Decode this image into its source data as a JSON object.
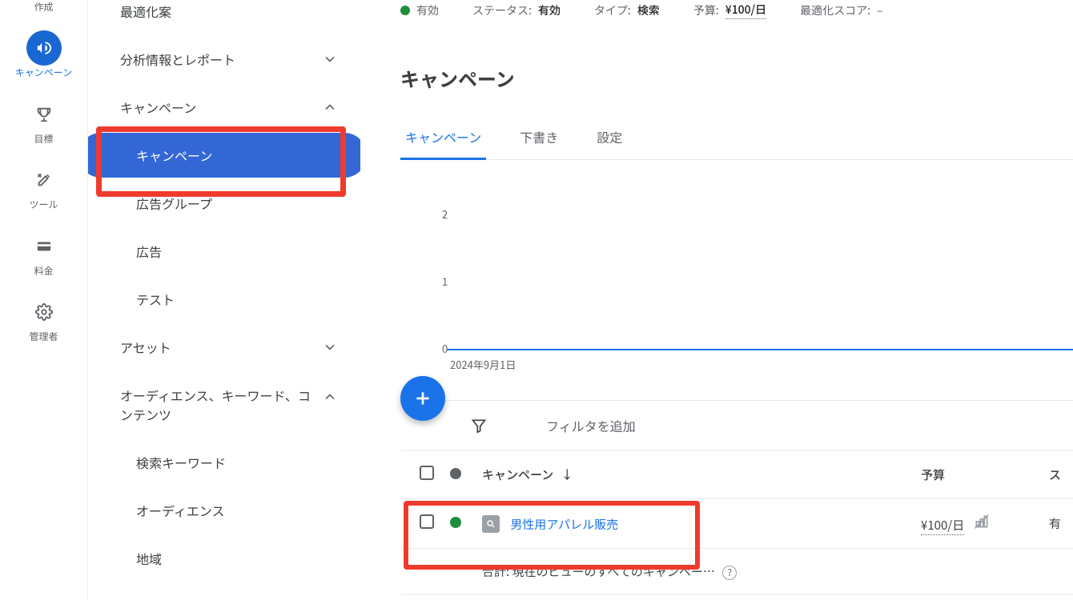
{
  "rail": {
    "items": [
      {
        "label": "作成",
        "icon": "plus"
      },
      {
        "label": "キャンペーン",
        "icon": "megaphone",
        "active": true
      },
      {
        "label": "目標",
        "icon": "trophy"
      },
      {
        "label": "ツール",
        "icon": "tools"
      },
      {
        "label": "料金",
        "icon": "card"
      },
      {
        "label": "管理者",
        "icon": "gear"
      }
    ]
  },
  "nav": {
    "sections": [
      {
        "label": "最適化案",
        "kind": "section",
        "expand": "none"
      },
      {
        "label": "分析情報とレポート",
        "kind": "section",
        "expand": "down"
      },
      {
        "label": "キャンペーン",
        "kind": "section",
        "expand": "up"
      },
      {
        "label": "キャンペーン",
        "kind": "sub",
        "selected": true
      },
      {
        "label": "広告グループ",
        "kind": "sub"
      },
      {
        "label": "広告",
        "kind": "sub"
      },
      {
        "label": "テスト",
        "kind": "sub"
      },
      {
        "label": "アセット",
        "kind": "section",
        "expand": "down"
      },
      {
        "label": "オーディエンス、キーワード、コンテンツ",
        "kind": "section",
        "expand": "up"
      },
      {
        "label": "検索キーワード",
        "kind": "sub"
      },
      {
        "label": "オーディエンス",
        "kind": "sub"
      },
      {
        "label": "地域",
        "kind": "sub"
      }
    ]
  },
  "statusbar": {
    "enabled_label": "有効",
    "status_label": "ステータス:",
    "status_value": "有効",
    "type_label": "タイプ:",
    "type_value": "検索",
    "budget_label": "予算:",
    "budget_value": "¥100/日",
    "opt_label": "最適化スコア:",
    "opt_value": "–"
  },
  "page_title": "キャンペーン",
  "tabs": [
    {
      "label": "キャンペーン",
      "active": true
    },
    {
      "label": "下書き"
    },
    {
      "label": "設定"
    }
  ],
  "chart_data": {
    "type": "line",
    "title": "",
    "xlabel": "",
    "ylabel": "",
    "x_start_label": "2024年9月1日",
    "y_ticks": [
      0,
      1,
      2
    ],
    "ylim": [
      0,
      2
    ],
    "series": [
      {
        "name": "",
        "values": [
          0
        ]
      }
    ]
  },
  "filter": {
    "placeholder": "フィルタを追加"
  },
  "table": {
    "headers": {
      "campaign": "キャンペーン",
      "budget": "予算",
      "status_partial": "ス"
    },
    "rows": [
      {
        "status_color": "#1e8e3e",
        "name": "男性用アパレル販売",
        "budget": "¥100/日",
        "status_partial": "有"
      }
    ],
    "summary": "合計: 現在のビューのすべてのキャンペー…"
  },
  "icons": {
    "chevron_down": "chevron-down-icon",
    "chevron_up": "chevron-up-icon",
    "filter": "funnel-icon",
    "plus": "plus-icon",
    "sort_down": "arrow-down-icon",
    "help": "?"
  }
}
